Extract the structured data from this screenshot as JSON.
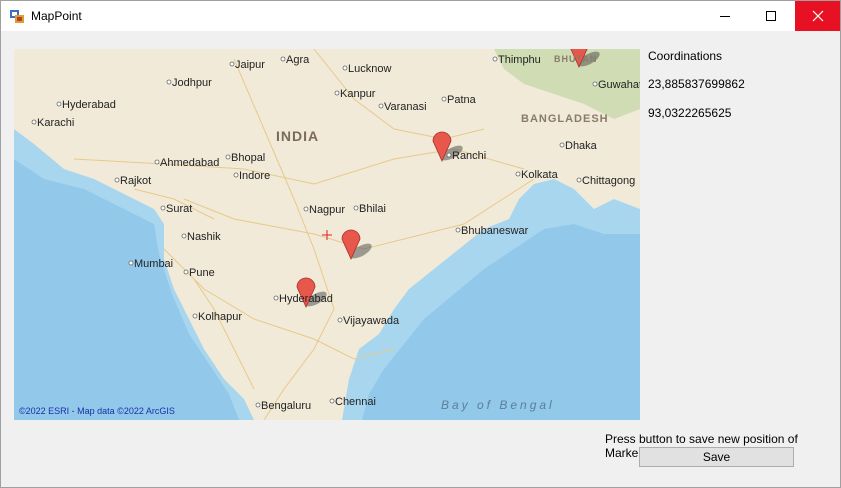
{
  "window": {
    "title": "MapPoint",
    "icon": "app-map-icon"
  },
  "caption_buttons": {
    "minimize_icon": "minimize-icon",
    "maximize_icon": "maximize-icon",
    "close_icon": "close-icon",
    "close_color": "#e81123"
  },
  "map": {
    "credit": "©2022 ESRI - Map data ©2022 ArcGIS",
    "country_label": "INDIA",
    "neighbor_labels": [
      "BANGLADESH",
      "BHUTAN"
    ],
    "water_label": "Bay of Bengal",
    "cities": [
      "Jaipur",
      "Agra",
      "Lucknow",
      "Thimphu",
      "Jodhpur",
      "Kanpur",
      "Guwahati",
      "Hyderabad",
      "Varanasi",
      "Patna",
      "Karachi",
      "Ranchi",
      "Dhaka",
      "Ahmedabad",
      "Bhopal",
      "Indore",
      "Kolkata",
      "Chittagong",
      "Rajkot",
      "Surat",
      "Nagpur",
      "Bhilai",
      "Bhubaneswar",
      "Nashik",
      "Mumbai",
      "Pune",
      "Hyderabad",
      "Kolhapur",
      "Vijayawada",
      "Bengaluru",
      "Chennai"
    ],
    "markers": [
      "map-marker",
      "map-marker",
      "map-marker",
      "map-marker"
    ],
    "crosshair": "crosshair-icon",
    "land_color": "#f1ead8",
    "water_color": "#a9d6ef",
    "marker_color": "#e8574b"
  },
  "sidebar": {
    "coord_label": "Coordinations",
    "latitude": "23,885837699862",
    "longitude": "93,0322265625"
  },
  "footer": {
    "hint": "Press button to save new position of Markers",
    "save_label": "Save"
  }
}
